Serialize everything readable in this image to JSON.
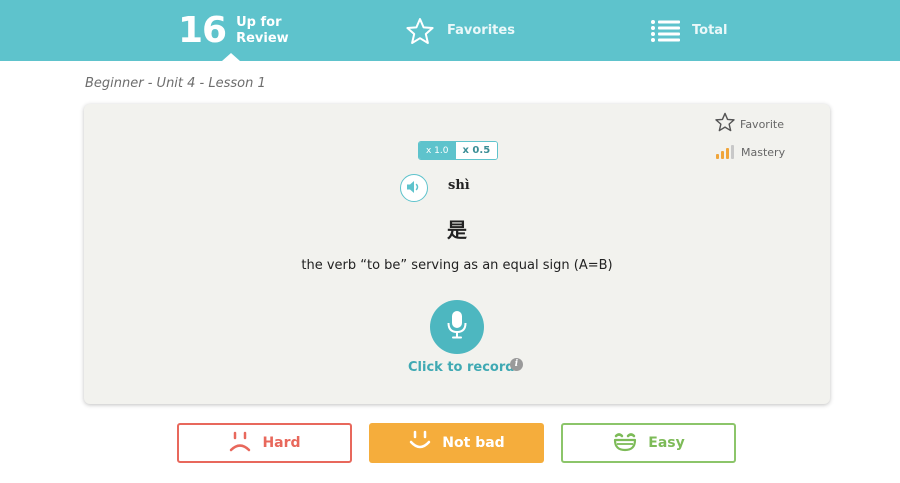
{
  "header": {
    "review_count": "16",
    "review_label_line1": "Up for",
    "review_label_line2": "Review",
    "favorites_label": "Favorites",
    "total_label": "Total"
  },
  "breadcrumb": "Beginner - Unit 4 - Lesson 1",
  "card": {
    "favorite_label": "Favorite",
    "mastery_label": "Mastery",
    "speed_options": [
      "x 1.0",
      "x 0.5"
    ],
    "speed_selected": "x 1.0",
    "pinyin": "shì",
    "hanzi": "是",
    "definition": "the verb “to be” serving as an equal sign (A=B)",
    "record_label": "Click to record",
    "info_glyph": "i"
  },
  "ratings": {
    "hard": "Hard",
    "not_bad": "Not bad",
    "easy": "Easy"
  },
  "colors": {
    "header_bg": "#5ec3cc",
    "card_bg": "#f2f2ee",
    "hard": "#e8685c",
    "not_bad": "#f5ad3c",
    "easy": "#8cc56a"
  }
}
